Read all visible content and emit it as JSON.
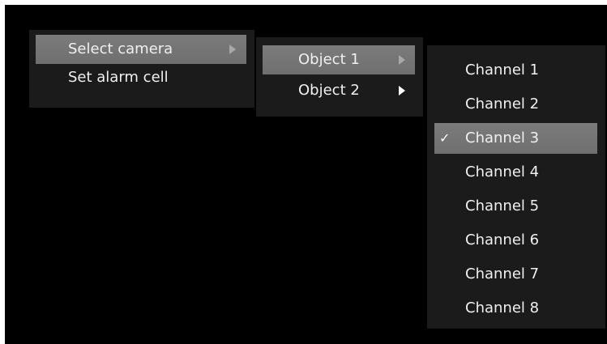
{
  "menus": {
    "main": {
      "items": [
        {
          "label": "Select camera"
        },
        {
          "label": "Set alarm cell"
        }
      ]
    },
    "objects": {
      "items": [
        {
          "label": "Object 1"
        },
        {
          "label": "Object 2"
        }
      ]
    },
    "channels": {
      "checkmark": "✓",
      "items": [
        {
          "label": "Channel 1"
        },
        {
          "label": "Channel 2"
        },
        {
          "label": "Channel 3"
        },
        {
          "label": "Channel 4"
        },
        {
          "label": "Channel 5"
        },
        {
          "label": "Channel 6"
        },
        {
          "label": "Channel 7"
        },
        {
          "label": "Channel 8"
        }
      ]
    }
  },
  "colors": {
    "background": "#000000",
    "menu_bg": "#1b1b1b",
    "highlight": "#777777",
    "text": "#f0f0f0"
  }
}
